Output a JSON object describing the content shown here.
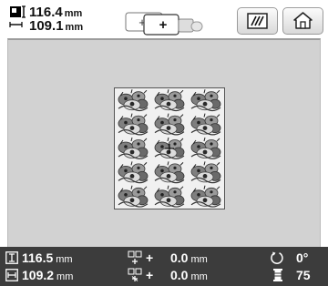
{
  "header": {
    "width_value": "116.4",
    "height_value": "109.1",
    "unit": "mm",
    "hoop_left_symbol": "+",
    "hoop_right_symbol": "+",
    "stitch_button_icon": "stitch-edit-icon",
    "home_button_icon": "home-icon"
  },
  "design": {
    "rows": 5,
    "cols": 3,
    "motif": "embroidery-flower-icon"
  },
  "status": {
    "height_value": "116.5",
    "width_value": "109.2",
    "unit": "mm",
    "offset_y_sign": "+",
    "offset_y_value": "0.0",
    "offset_x_sign": "+",
    "offset_x_value": "0.0",
    "rotation_value": "0°",
    "thread_count": "75"
  },
  "colors": {
    "status_bar": "#3c3c3c",
    "edit_area": "#d2d2d2",
    "design_bg": "#f1f1f1"
  }
}
